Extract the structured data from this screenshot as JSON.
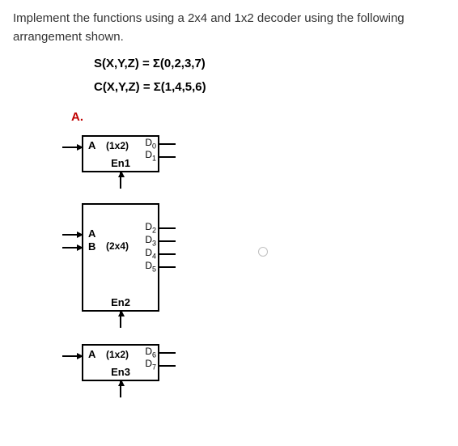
{
  "problem": {
    "text": "Implement the functions using a 2x4 and 1x2 decoder using the following arrangement shown.",
    "eq1": "S(X,Y,Z) = Σ(0,2,3,7)",
    "eq2": "C(X,Y,Z) = Σ(1,4,5,6)",
    "part_label": "A."
  },
  "blocks": {
    "b1": {
      "inputA": "A",
      "type": "(1x2)",
      "enable": "En1",
      "outputs": [
        "D",
        "D"
      ],
      "out_sub": [
        "0",
        "1"
      ]
    },
    "b2": {
      "inputA": "A",
      "inputB": "B",
      "type": "(2x4)",
      "enable": "En2",
      "outputs": [
        "D",
        "D",
        "D",
        "D"
      ],
      "out_sub": [
        "2",
        "3",
        "4",
        "5"
      ]
    },
    "b3": {
      "inputA": "A",
      "type": "(1x2)",
      "enable": "En3",
      "outputs": [
        "D",
        "D"
      ],
      "out_sub": [
        "6",
        "7"
      ]
    }
  }
}
